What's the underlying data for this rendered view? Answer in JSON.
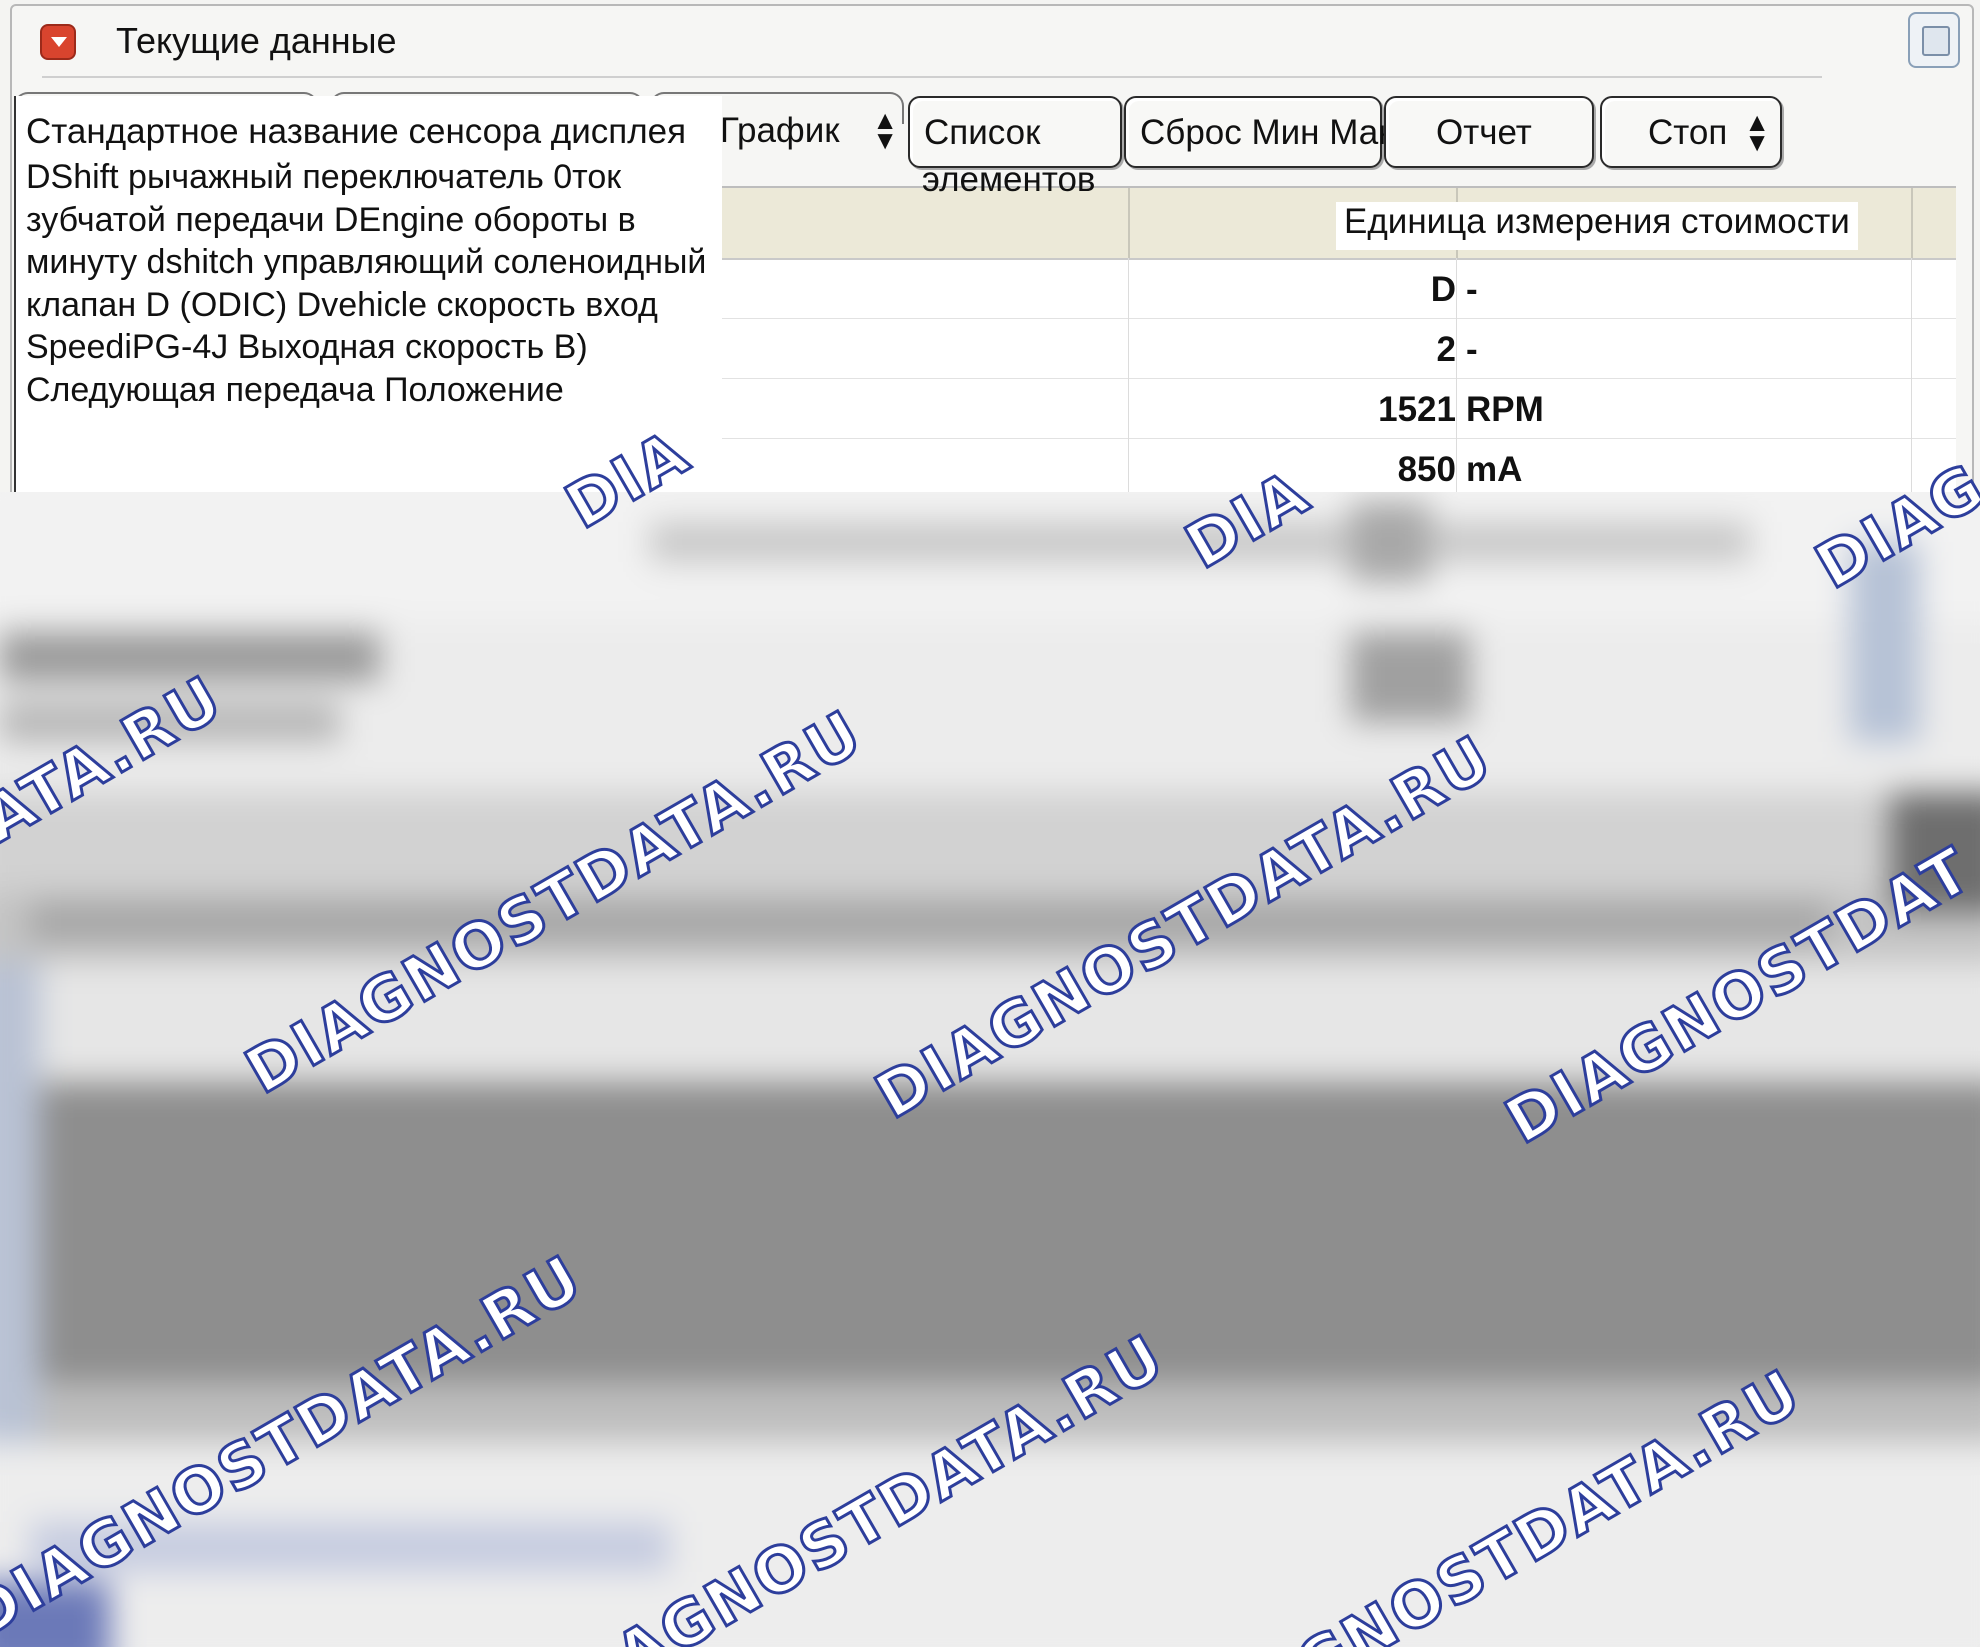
{
  "window": {
    "title": "Текущие данные"
  },
  "toolbar": {
    "graph_label": "График",
    "items_list_label_line1": "Список",
    "items_list_label_line2": "элементов",
    "reset_minmax_label": "Сброс Мин Макс",
    "report_label": "Отчет",
    "stop_label": "Стоп"
  },
  "table": {
    "header_name": "Стандартное название сенсора дисплея",
    "header_unit": "Единица измерения стоимости",
    "rows": [
      {
        "value": "D",
        "unit": "-"
      },
      {
        "value": "2",
        "unit": "-"
      },
      {
        "value": "1521",
        "unit": "RPM"
      },
      {
        "value": "850",
        "unit": "mA"
      }
    ]
  },
  "tooltip": {
    "text": "DShift рычажный переключатель 0ток зубчатой передачи DEngine обороты в минуту dshitch управляющий соленоидный клапан D (ODIC) Dvehicle скорость вход SpeediPG-4J Выходная скорость B) Следующая передача Положение"
  },
  "watermark": {
    "prefix": "DIA",
    "text": "DIAGNOSTDATA.RU",
    "tail_1": "DATA.RU",
    "tail_2": "DIAGNOSTDAT",
    "head_1": "DIAGNOSTDATA.RU",
    "head_2": "AGNOSTDATA.RU",
    "head_3": "GNOSTDATA.RU",
    "head_4": "DIAG"
  },
  "colors": {
    "window_bg": "#f4f4f2",
    "header_bg": "#ece9d8",
    "accent_icon": "#d9442e",
    "watermark_stroke": "#2d3e9c"
  }
}
